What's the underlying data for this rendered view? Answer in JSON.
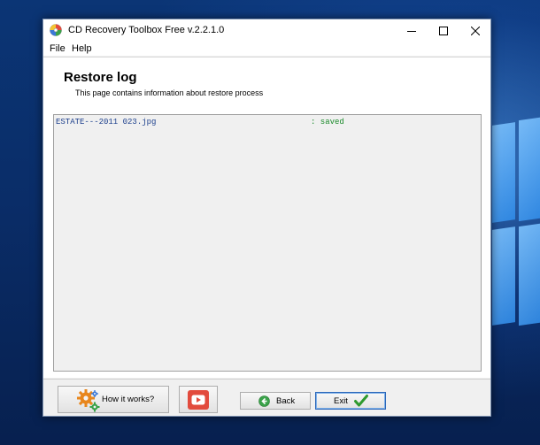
{
  "window": {
    "title": "CD Recovery Toolbox Free v.2.2.1.0"
  },
  "titlebar_buttons": {
    "minimize_icon": "minimize-icon",
    "maximize_icon": "maximize-icon",
    "close_icon": "close-icon"
  },
  "menu": {
    "items": [
      {
        "label": "File"
      },
      {
        "label": "Help"
      }
    ]
  },
  "page": {
    "title": "Restore log",
    "subtitle": "This page contains information about restore process"
  },
  "log": {
    "rows": [
      {
        "file": "ESTATE---2011 023.jpg",
        "status": ": saved"
      }
    ]
  },
  "footer": {
    "how_label": "How it works?",
    "back_label": "Back",
    "exit_label": "Exit"
  },
  "colors": {
    "log_file_text": "#1c3f8c",
    "log_status_text": "#1a8a2a",
    "youtube_red": "#e24b3d",
    "exit_check_green": "#2e9a2e"
  }
}
